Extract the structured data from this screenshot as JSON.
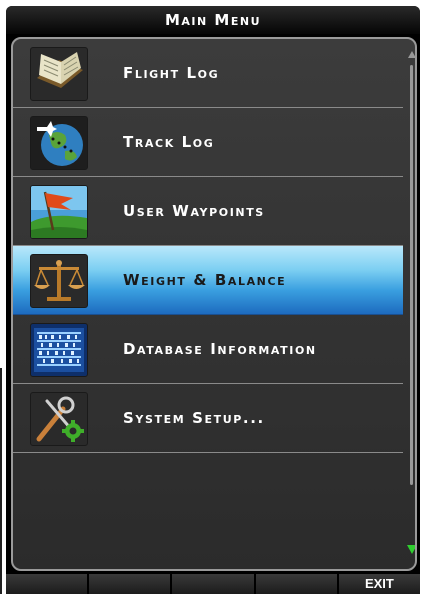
{
  "header": {
    "title": "Main Menu"
  },
  "menu": {
    "items": [
      {
        "label": "Flight Log",
        "icon": "flight-log-book-icon"
      },
      {
        "label": "Track Log",
        "icon": "track-log-globe-icon"
      },
      {
        "label": "User Waypoints",
        "icon": "user-waypoints-flag-icon"
      },
      {
        "label": "Weight & Balance",
        "icon": "weight-balance-scale-icon",
        "selected": true
      },
      {
        "label": "Database Information",
        "icon": "database-binary-icon"
      },
      {
        "label": "System Setup...",
        "icon": "system-setup-tools-icon"
      }
    ]
  },
  "softkeys": [
    "",
    "",
    "",
    "",
    "EXIT"
  ],
  "colors": {
    "selection_top": "#b9e8fb",
    "selection_bottom": "#1d6bbf",
    "scroll_down_arrow": "#2fcf2f"
  }
}
